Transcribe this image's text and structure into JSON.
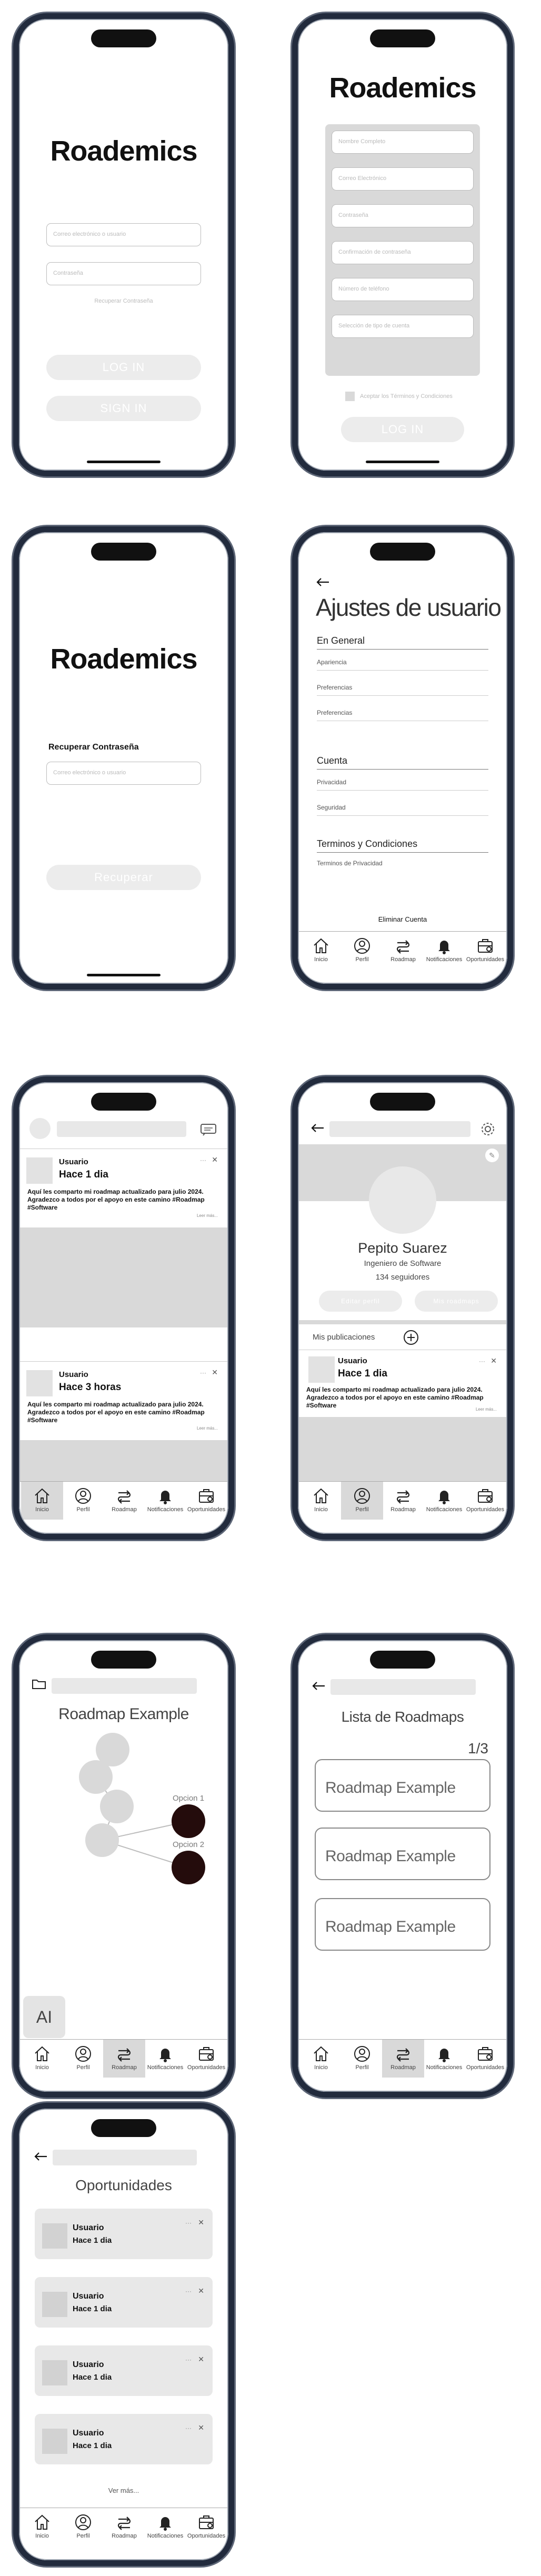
{
  "app_name": "Roademics",
  "login": {
    "email_placeholder": "Correo electrónico o usuario",
    "password_placeholder": "Contraseña",
    "forgot": "Recuperar Contraseña",
    "login_btn": "LOG IN",
    "signin_btn": "SIGN IN"
  },
  "signup": {
    "fields": [
      "Nombre Completo",
      "Correo Electrónico",
      "Contraseña",
      "Confirmación de contraseña",
      "Número de teléfono",
      "Selección de tipo de cuenta"
    ],
    "terms": "Aceptar los Términos y Condiciones",
    "login_btn": "LOG IN"
  },
  "recover": {
    "label": "Recuperar Contraseña",
    "email_placeholder": "Correo electrónico o usuario",
    "button": "Recuperar"
  },
  "settings": {
    "title": "Ajustes de usuario",
    "general_head": "En General",
    "general_items": [
      "Apariencia",
      "Preferencias",
      "Preferencias"
    ],
    "account_head": "Cuenta",
    "account_items": [
      "Privacidad",
      "Seguridad"
    ],
    "terms_head": "Terminos y Condiciones",
    "terms_items": [
      "Terminos de Privacidad"
    ],
    "delete": "Eliminar Cuenta"
  },
  "nav": {
    "inicio": "Inicio",
    "perfil": "Perfil",
    "roadmap": "Roadmap",
    "notificaciones": "Notificaciones",
    "oportunidades": "Oportunidades"
  },
  "feed": {
    "posts": [
      {
        "user": "Usuario",
        "time": "Hace 1 dia",
        "body": "Aquí les comparto mi roadmap actualizado para julio 2024. Agradezco a todos por el apoyo en este camino #Roadmap #Software",
        "more": "Leer más..."
      },
      {
        "user": "Usuario",
        "time": "Hace 3 horas",
        "body": "Aquí les comparto mi roadmap actualizado para julio 2024. Agradezco a todos por el apoyo en este camino #Roadmap #Software",
        "more": "Leer más..."
      }
    ]
  },
  "profile": {
    "name": "Pepito Suarez",
    "role": "Ingeniero de Software",
    "followers": "134 seguidores",
    "edit_btn": "Editar perfil",
    "roadmaps_btn": "Mis roadmaps",
    "publications": "Mis publicaciones",
    "post": {
      "user": "Usuario",
      "time": "Hace 1 dia",
      "body": "Aquí les comparto mi roadmap actualizado para julio 2024. Agradezco a todos por el apoyo en este camino #Roadmap #Software",
      "more": "Leer más..."
    }
  },
  "roadmap": {
    "title": "Roadmap Example",
    "option1": "Opcion 1",
    "option2": "Opcion 2",
    "ai": "AI"
  },
  "roadmap_list": {
    "title": "Lista de Roadmaps",
    "page": "1/3",
    "items": [
      "Roadmap Example",
      "Roadmap Example",
      "Roadmap Example"
    ]
  },
  "opportunities": {
    "title": "Oportunidades",
    "cards": [
      {
        "user": "Usuario",
        "time": "Hace 1 dia"
      },
      {
        "user": "Usuario",
        "time": "Hace 1 dia"
      },
      {
        "user": "Usuario",
        "time": "Hace 1 dia"
      },
      {
        "user": "Usuario",
        "time": "Hace 1 dia"
      }
    ],
    "more": "Ver más..."
  }
}
